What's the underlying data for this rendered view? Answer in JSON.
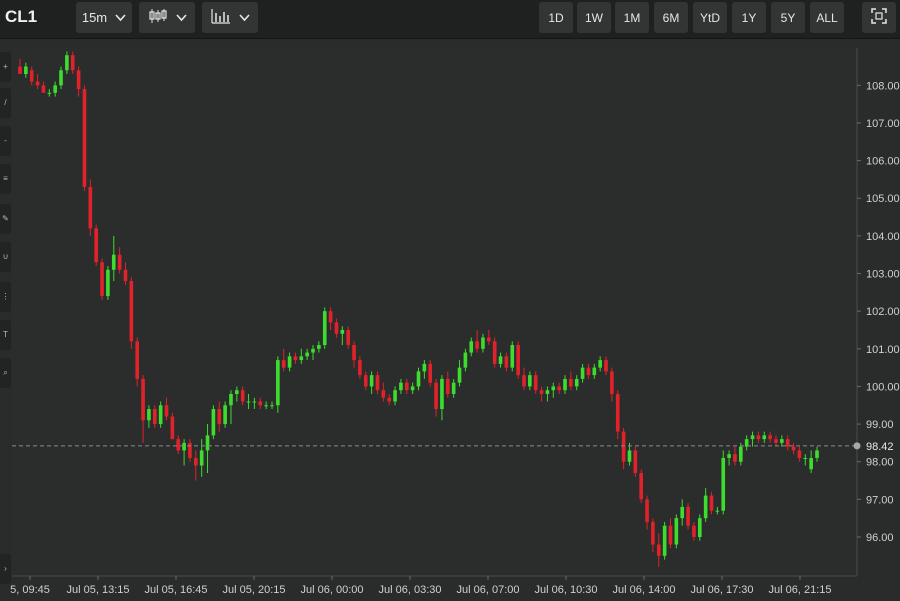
{
  "toolbar": {
    "ticker": "CL1",
    "interval": "15m",
    "candle_icon": "candlestick-icon",
    "study_icon": "bar-chart-icon",
    "ranges": [
      "1D",
      "1W",
      "1M",
      "6M",
      "YtD",
      "1Y",
      "5Y",
      "ALL"
    ],
    "fullscreen_icon": "fullscreen-icon"
  },
  "chart_data": {
    "type": "candlestick",
    "price_line": {
      "value": 98.42,
      "label": "98.42"
    },
    "ylim": [
      95.0,
      109.0
    ],
    "y_ticks": [
      96.0,
      97.0,
      98.0,
      99.0,
      100.0,
      101.0,
      102.0,
      103.0,
      104.0,
      105.0,
      106.0,
      107.0,
      108.0
    ],
    "y_tick_labels": [
      "96.00",
      "97.00",
      "98.00",
      "99.00",
      "100.00",
      "101.00",
      "102.00",
      "103.00",
      "104.00",
      "105.00",
      "106.00",
      "107.00",
      "108.00"
    ],
    "x_tick_labels": [
      "5, 09:45",
      "Jul 05, 13:15",
      "Jul 05, 16:45",
      "Jul 05, 20:15",
      "Jul 06, 00:00",
      "Jul 06, 03:30",
      "Jul 06, 07:00",
      "Jul 06, 10:30",
      "Jul 06, 14:00",
      "Jul 06, 17:30",
      "Jul 06, 21:15"
    ],
    "up_color": "#3ddc2e",
    "down_color": "#e0222b",
    "candles": [
      [
        108.5,
        108.7,
        108.3,
        108.3
      ],
      [
        108.3,
        108.6,
        108.2,
        108.5
      ],
      [
        108.4,
        108.5,
        108.0,
        108.1
      ],
      [
        108.1,
        108.3,
        107.9,
        108.0
      ],
      [
        108.0,
        108.1,
        107.8,
        107.8
      ],
      [
        107.8,
        107.9,
        107.7,
        107.8
      ],
      [
        107.8,
        108.1,
        107.7,
        108.0
      ],
      [
        108.0,
        108.5,
        107.9,
        108.4
      ],
      [
        108.4,
        108.9,
        108.3,
        108.8
      ],
      [
        108.8,
        108.9,
        108.3,
        108.4
      ],
      [
        108.4,
        108.5,
        107.7,
        107.9
      ],
      [
        107.9,
        108.0,
        105.2,
        105.3
      ],
      [
        105.3,
        105.5,
        104.0,
        104.2
      ],
      [
        104.2,
        104.3,
        103.2,
        103.3
      ],
      [
        103.3,
        103.4,
        102.3,
        102.4
      ],
      [
        102.4,
        103.2,
        102.3,
        103.1
      ],
      [
        103.1,
        104.0,
        102.8,
        103.5
      ],
      [
        103.5,
        103.7,
        103.0,
        103.1
      ],
      [
        103.1,
        103.3,
        102.7,
        102.8
      ],
      [
        102.8,
        102.9,
        101.0,
        101.2
      ],
      [
        101.2,
        101.3,
        100.0,
        100.2
      ],
      [
        100.2,
        100.3,
        98.5,
        99.1
      ],
      [
        99.1,
        99.5,
        98.9,
        99.4
      ],
      [
        99.4,
        99.5,
        98.9,
        99.0
      ],
      [
        99.0,
        99.6,
        98.9,
        99.5
      ],
      [
        99.5,
        99.7,
        99.1,
        99.2
      ],
      [
        99.2,
        99.3,
        98.6,
        98.6
      ],
      [
        98.6,
        98.7,
        98.2,
        98.3
      ],
      [
        98.3,
        98.6,
        97.9,
        98.5
      ],
      [
        98.5,
        98.6,
        98.0,
        98.1
      ],
      [
        98.1,
        98.3,
        97.5,
        97.9
      ],
      [
        97.9,
        98.6,
        97.6,
        98.3
      ],
      [
        98.3,
        99.0,
        97.7,
        98.7
      ],
      [
        98.7,
        99.5,
        98.6,
        99.4
      ],
      [
        99.4,
        99.6,
        98.8,
        99.0
      ],
      [
        99.0,
        99.6,
        98.9,
        99.5
      ],
      [
        99.5,
        99.9,
        99.0,
        99.8
      ],
      [
        99.8,
        100.0,
        99.6,
        99.9
      ],
      [
        99.9,
        100.0,
        99.5,
        99.6
      ],
      [
        99.6,
        99.8,
        99.4,
        99.6
      ],
      [
        99.6,
        99.7,
        99.4,
        99.6
      ],
      [
        99.6,
        99.7,
        99.4,
        99.5
      ],
      [
        99.5,
        99.6,
        99.4,
        99.5
      ],
      [
        99.5,
        99.6,
        99.4,
        99.5
      ],
      [
        99.5,
        100.8,
        99.3,
        100.7
      ],
      [
        100.7,
        101.0,
        100.4,
        100.5
      ],
      [
        100.5,
        100.9,
        100.4,
        100.8
      ],
      [
        100.8,
        100.9,
        100.6,
        100.7
      ],
      [
        100.7,
        101.0,
        100.6,
        100.8
      ],
      [
        100.8,
        101.0,
        100.7,
        100.9
      ],
      [
        100.9,
        101.1,
        100.7,
        101.0
      ],
      [
        101.0,
        101.2,
        100.9,
        101.1
      ],
      [
        101.1,
        102.1,
        101.0,
        102.0
      ],
      [
        102.0,
        102.1,
        101.5,
        101.7
      ],
      [
        101.7,
        101.8,
        101.3,
        101.4
      ],
      [
        101.4,
        101.6,
        101.1,
        101.5
      ],
      [
        101.5,
        101.6,
        101.0,
        101.1
      ],
      [
        101.1,
        101.2,
        100.5,
        100.7
      ],
      [
        100.7,
        100.8,
        100.2,
        100.3
      ],
      [
        100.3,
        100.4,
        99.9,
        100.0
      ],
      [
        100.0,
        100.4,
        99.8,
        100.3
      ],
      [
        100.3,
        100.4,
        99.8,
        99.9
      ],
      [
        99.9,
        100.1,
        99.6,
        99.7
      ],
      [
        99.7,
        99.8,
        99.5,
        99.6
      ],
      [
        99.6,
        100.0,
        99.5,
        99.9
      ],
      [
        99.9,
        100.2,
        99.8,
        100.1
      ],
      [
        100.1,
        100.2,
        99.8,
        99.9
      ],
      [
        99.9,
        100.1,
        99.8,
        100.0
      ],
      [
        100.0,
        100.5,
        99.9,
        100.4
      ],
      [
        100.4,
        100.7,
        100.2,
        100.6
      ],
      [
        100.6,
        100.7,
        100.0,
        100.1
      ],
      [
        100.1,
        100.2,
        99.2,
        99.4
      ],
      [
        99.4,
        100.3,
        99.1,
        100.2
      ],
      [
        100.2,
        100.4,
        99.7,
        99.8
      ],
      [
        99.8,
        100.2,
        99.7,
        100.1
      ],
      [
        100.1,
        100.7,
        100.0,
        100.5
      ],
      [
        100.5,
        101.0,
        100.4,
        100.9
      ],
      [
        100.9,
        101.3,
        100.8,
        101.2
      ],
      [
        101.2,
        101.5,
        100.9,
        101.0
      ],
      [
        101.0,
        101.4,
        100.9,
        101.3
      ],
      [
        101.3,
        101.5,
        101.1,
        101.2
      ],
      [
        101.2,
        101.3,
        100.5,
        100.6
      ],
      [
        100.6,
        100.9,
        100.5,
        100.8
      ],
      [
        100.8,
        100.9,
        100.4,
        100.5
      ],
      [
        100.5,
        101.2,
        100.4,
        101.1
      ],
      [
        101.1,
        101.2,
        100.2,
        100.3
      ],
      [
        100.3,
        100.5,
        99.9,
        100.0
      ],
      [
        100.0,
        100.4,
        99.9,
        100.3
      ],
      [
        100.3,
        100.4,
        99.8,
        99.9
      ],
      [
        99.9,
        100.0,
        99.6,
        99.8
      ],
      [
        99.8,
        100.0,
        99.6,
        99.9
      ],
      [
        99.9,
        100.1,
        99.7,
        100.0
      ],
      [
        100.0,
        100.1,
        99.8,
        99.9
      ],
      [
        99.9,
        100.3,
        99.8,
        100.2
      ],
      [
        100.2,
        100.4,
        99.9,
        100.0
      ],
      [
        100.0,
        100.3,
        99.9,
        100.2
      ],
      [
        100.2,
        100.6,
        100.1,
        100.5
      ],
      [
        100.5,
        100.6,
        100.2,
        100.3
      ],
      [
        100.3,
        100.6,
        100.2,
        100.5
      ],
      [
        100.5,
        100.8,
        100.4,
        100.7
      ],
      [
        100.7,
        100.8,
        100.3,
        100.4
      ],
      [
        100.4,
        100.5,
        99.6,
        99.8
      ],
      [
        99.8,
        99.9,
        98.6,
        98.8
      ],
      [
        98.8,
        98.9,
        97.8,
        98.0
      ],
      [
        98.0,
        98.5,
        97.9,
        98.3
      ],
      [
        98.3,
        98.4,
        97.6,
        97.7
      ],
      [
        97.7,
        97.8,
        96.9,
        97.0
      ],
      [
        97.0,
        97.1,
        96.2,
        96.4
      ],
      [
        96.4,
        96.5,
        95.6,
        95.8
      ],
      [
        95.8,
        96.1,
        95.2,
        95.5
      ],
      [
        95.5,
        96.4,
        95.4,
        96.3
      ],
      [
        96.3,
        96.5,
        95.7,
        95.8
      ],
      [
        95.8,
        96.6,
        95.7,
        96.5
      ],
      [
        96.5,
        97.0,
        96.3,
        96.8
      ],
      [
        96.8,
        96.9,
        96.2,
        96.3
      ],
      [
        96.3,
        96.4,
        95.9,
        96.0
      ],
      [
        96.0,
        96.6,
        95.9,
        96.5
      ],
      [
        96.5,
        97.3,
        96.4,
        97.1
      ],
      [
        97.1,
        97.2,
        96.6,
        96.7
      ],
      [
        96.7,
        96.8,
        96.6,
        96.7
      ],
      [
        96.7,
        98.3,
        96.6,
        98.1
      ],
      [
        98.1,
        98.3,
        97.9,
        98.2
      ],
      [
        98.2,
        98.4,
        97.9,
        98.0
      ],
      [
        98.0,
        98.5,
        97.9,
        98.4
      ],
      [
        98.4,
        98.7,
        98.3,
        98.6
      ],
      [
        98.6,
        98.8,
        98.4,
        98.7
      ],
      [
        98.7,
        98.8,
        98.5,
        98.6
      ],
      [
        98.6,
        98.8,
        98.5,
        98.7
      ],
      [
        98.7,
        98.8,
        98.5,
        98.6
      ],
      [
        98.6,
        98.7,
        98.4,
        98.5
      ],
      [
        98.5,
        98.7,
        98.4,
        98.6
      ],
      [
        98.6,
        98.7,
        98.3,
        98.4
      ],
      [
        98.4,
        98.5,
        98.2,
        98.3
      ],
      [
        98.3,
        98.4,
        98.0,
        98.1
      ],
      [
        98.1,
        98.2,
        97.9,
        98.1
      ],
      [
        97.8,
        98.3,
        97.7,
        98.1
      ],
      [
        98.1,
        98.4,
        98.0,
        98.3
      ]
    ]
  }
}
